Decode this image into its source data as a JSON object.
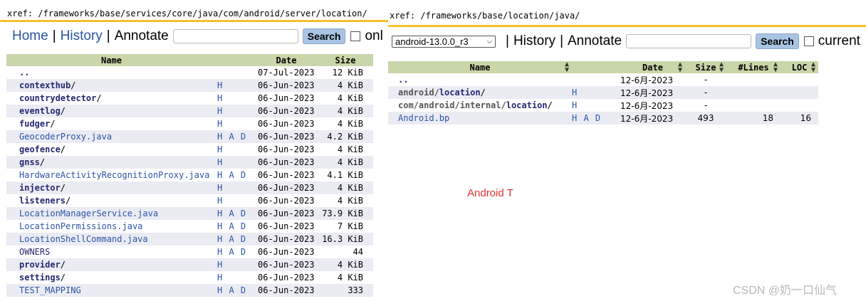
{
  "left": {
    "xref": "xref: /frameworks/base/services/core/java/com/android/server/location/",
    "nav": {
      "home": "Home",
      "history": "History",
      "annotate": "Annotate",
      "separator": "|",
      "search_button": "Search",
      "checkbox_label": "onl"
    },
    "headers": {
      "name": "Name",
      "date": "Date",
      "size": "Size"
    },
    "rows": [
      {
        "name": "..",
        "kind": "dir",
        "hist": "",
        "date": "07-Jul-2023",
        "size": "12 KiB"
      },
      {
        "name": "contexthub",
        "suffix": "/",
        "kind": "dir",
        "hist": "H",
        "date": "06-Jun-2023",
        "size": "4 KiB"
      },
      {
        "name": "countrydetector",
        "suffix": "/",
        "kind": "dir",
        "hist": "H",
        "date": "06-Jun-2023",
        "size": "4 KiB"
      },
      {
        "name": "eventlog",
        "suffix": "/",
        "kind": "dir",
        "hist": "H",
        "date": "06-Jun-2023",
        "size": "4 KiB"
      },
      {
        "name": "fudger",
        "suffix": "/",
        "kind": "dir",
        "hist": "H",
        "date": "06-Jun-2023",
        "size": "4 KiB"
      },
      {
        "name": "GeocoderProxy.java",
        "kind": "file",
        "hist": "H A D",
        "date": "06-Jun-2023",
        "size": "4.2 KiB"
      },
      {
        "name": "geofence",
        "suffix": "/",
        "kind": "dir",
        "hist": "H",
        "date": "06-Jun-2023",
        "size": "4 KiB"
      },
      {
        "name": "gnss",
        "suffix": "/",
        "kind": "dir",
        "hist": "H",
        "date": "06-Jun-2023",
        "size": "4 KiB"
      },
      {
        "name": "HardwareActivityRecognitionProxy.java",
        "kind": "file",
        "hist": "H A D",
        "date": "06-Jun-2023",
        "size": "4.1 KiB"
      },
      {
        "name": "injector",
        "suffix": "/",
        "kind": "dir",
        "hist": "H",
        "date": "06-Jun-2023",
        "size": "4 KiB"
      },
      {
        "name": "listeners",
        "suffix": "/",
        "kind": "dir",
        "hist": "H",
        "date": "06-Jun-2023",
        "size": "4 KiB"
      },
      {
        "name": "LocationManagerService.java",
        "kind": "file",
        "hist": "H A D",
        "date": "06-Jun-2023",
        "size": "73.9 KiB"
      },
      {
        "name": "LocationPermissions.java",
        "kind": "file",
        "hist": "H A D",
        "date": "06-Jun-2023",
        "size": "7 KiB"
      },
      {
        "name": "LocationShellCommand.java",
        "kind": "file",
        "hist": "H A D",
        "date": "06-Jun-2023",
        "size": "16.3 KiB"
      },
      {
        "name": "OWNERS",
        "kind": "owner",
        "hist": "H A D",
        "date": "06-Jun-2023",
        "size": "44"
      },
      {
        "name": "provider",
        "suffix": "/",
        "kind": "dir",
        "hist": "H",
        "date": "06-Jun-2023",
        "size": "4 KiB"
      },
      {
        "name": "settings",
        "suffix": "/",
        "kind": "dir",
        "hist": "H",
        "date": "06-Jun-2023",
        "size": "4 KiB"
      },
      {
        "name": "TEST_MAPPING",
        "kind": "file",
        "hist": "H A D",
        "date": "06-Jun-2023",
        "size": "333"
      }
    ]
  },
  "right": {
    "xref": "xref: /frameworks/base/location/java/",
    "nav": {
      "select_value": "android-13.0.0_r3",
      "history": "History",
      "annotate": "Annotate",
      "separator": "|",
      "search_button": "Search",
      "checkbox_label": "current"
    },
    "headers": {
      "name": "Name",
      "date": "Date",
      "size": "Size",
      "lines": "#Lines",
      "loc": "LOC"
    },
    "rows": [
      {
        "prefix": "",
        "name": "..",
        "suffix": "",
        "kind": "dir",
        "hist": "",
        "date": "12-6月-2023",
        "size": "-",
        "lines": "",
        "loc": ""
      },
      {
        "prefix": "android/",
        "name": "location",
        "suffix": "/",
        "kind": "dir",
        "hist": "H",
        "date": "12-6月-2023",
        "size": "-",
        "lines": "",
        "loc": ""
      },
      {
        "prefix": "com/android/internal/",
        "name": "location",
        "suffix": "/",
        "kind": "dir",
        "hist": "H",
        "date": "12-6月-2023",
        "size": "-",
        "lines": "",
        "loc": ""
      },
      {
        "prefix": "",
        "name": "Android.bp",
        "suffix": "",
        "kind": "file",
        "hist": "H A D",
        "date": "12-6月-2023",
        "size": "493",
        "lines": "18",
        "loc": "16"
      }
    ],
    "annotation": "Android T"
  },
  "watermark": "CSDN @奶一口仙气",
  "colors": {
    "accent_line": "#f5c02a",
    "header_bg": "#c9d6a9",
    "alt_row_bg": "#ebecf3",
    "link": "#2b54a6",
    "dir": "#262872",
    "annotation": "#e03131"
  }
}
